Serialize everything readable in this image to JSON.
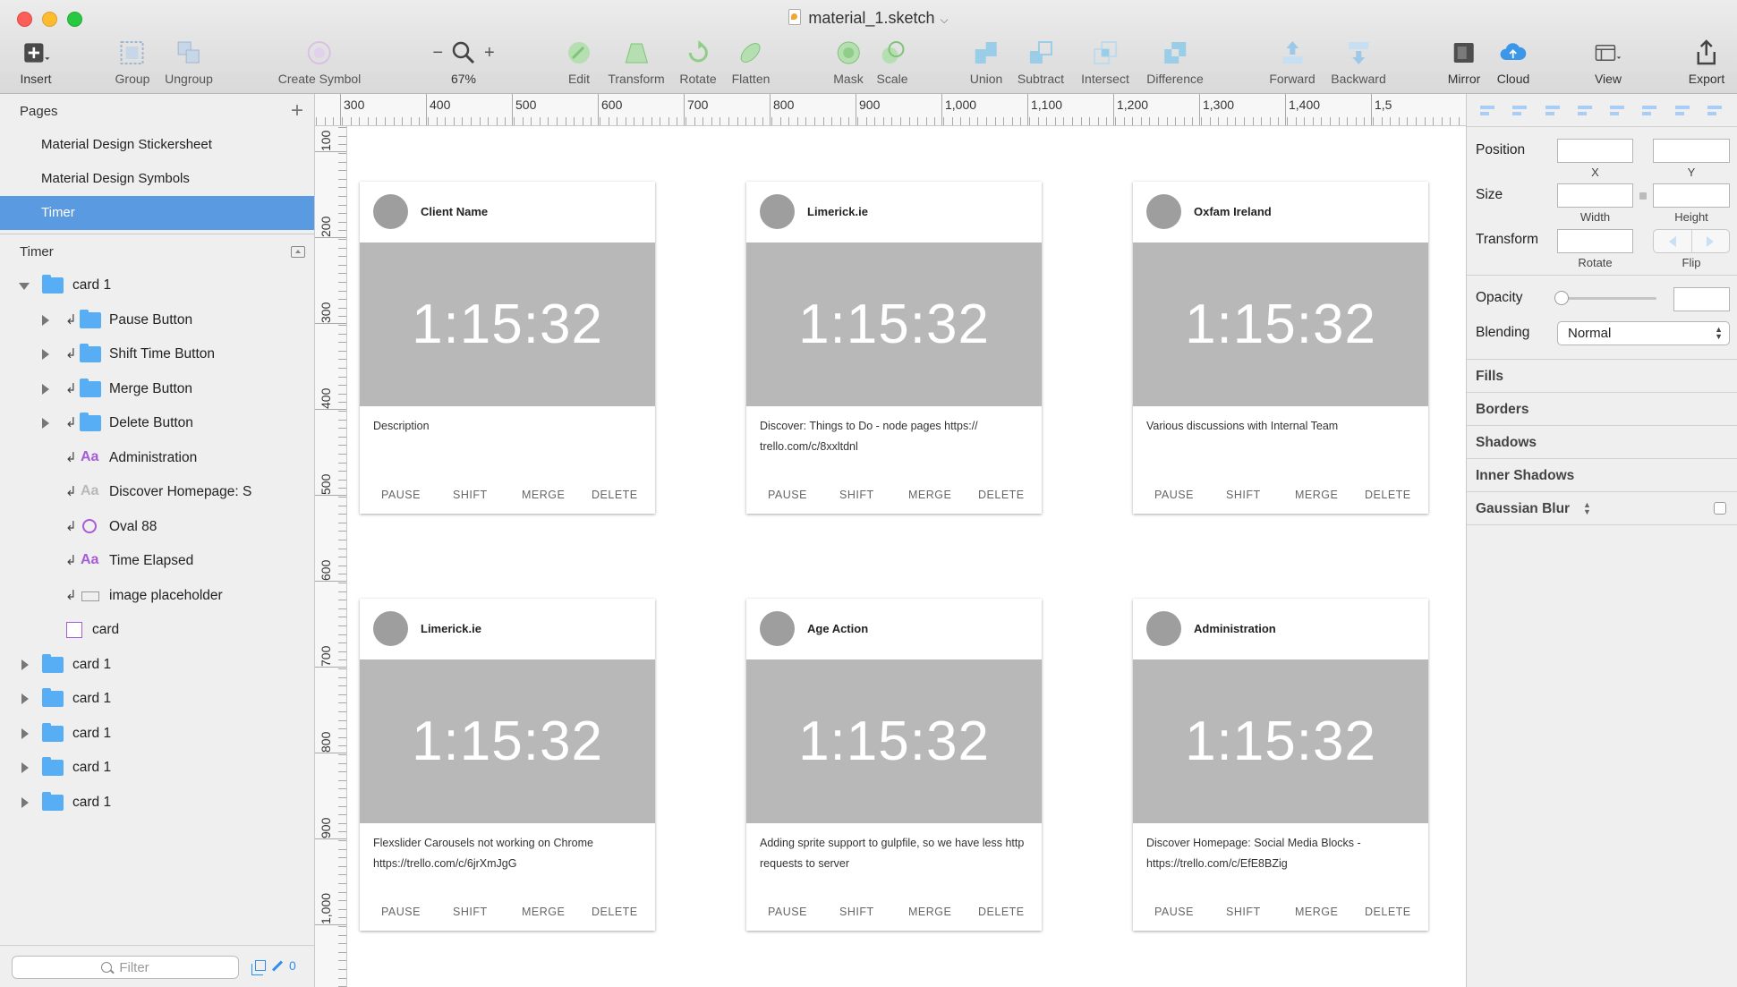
{
  "window": {
    "title": "material_1.sketch",
    "colors": {
      "accent": "#5a9ae0",
      "card_timer_bg": "#b8b8b8",
      "avatar": "#9e9e9e"
    }
  },
  "toolbar": {
    "insert": "Insert",
    "group": "Group",
    "ungroup": "Ungroup",
    "create_symbol": "Create Symbol",
    "zoom_minus": "−",
    "zoom_plus": "+",
    "zoom_level": "67%",
    "edit": "Edit",
    "transform": "Transform",
    "rotate": "Rotate",
    "flatten": "Flatten",
    "mask": "Mask",
    "scale": "Scale",
    "union": "Union",
    "subtract": "Subtract",
    "intersect": "Intersect",
    "difference": "Difference",
    "forward": "Forward",
    "backward": "Backward",
    "mirror": "Mirror",
    "cloud": "Cloud",
    "view": "View",
    "export": "Export"
  },
  "sidebar": {
    "pages_title": "Pages",
    "pages": [
      {
        "label": "Material Design Stickersheet"
      },
      {
        "label": "Material Design Symbols"
      },
      {
        "label": "Timer",
        "selected": true
      }
    ],
    "layers_title": "Timer",
    "layers": [
      {
        "label": "card 1",
        "type": "folder",
        "expanded": true
      },
      {
        "label": "Pause Button",
        "type": "folder"
      },
      {
        "label": "Shift Time Button",
        "type": "folder"
      },
      {
        "label": "Merge Button",
        "type": "folder"
      },
      {
        "label": "Delete Button",
        "type": "folder"
      },
      {
        "label": "Administration",
        "type": "text"
      },
      {
        "label": "Discover Homepage: S",
        "type": "text"
      },
      {
        "label": "Oval 88",
        "type": "oval"
      },
      {
        "label": "Time Elapsed",
        "type": "text"
      },
      {
        "label": "image placeholder",
        "type": "rect"
      },
      {
        "label": "card",
        "type": "shape"
      },
      {
        "label": "card 1",
        "type": "folder"
      },
      {
        "label": "card 1",
        "type": "folder"
      },
      {
        "label": "card 1",
        "type": "folder"
      },
      {
        "label": "card 1",
        "type": "folder"
      },
      {
        "label": "card 1",
        "type": "folder"
      }
    ],
    "filter_placeholder": "Filter",
    "filter_count": "0"
  },
  "ruler": {
    "top_labels": [
      "300",
      "400",
      "500",
      "600",
      "700",
      "800",
      "900",
      "1,000",
      "1,100",
      "1,200",
      "1,300",
      "1,400",
      "1,5"
    ],
    "left_labels": [
      "100",
      "200",
      "300",
      "400",
      "500",
      "600",
      "700",
      "800",
      "900",
      "1,000"
    ]
  },
  "cards": [
    {
      "client": "Client Name",
      "time": "1:15:32",
      "description": "Description"
    },
    {
      "client": "Limerick.ie",
      "time": "1:15:32",
      "description": "Discover: Things to Do - node pages https:// trello.com/c/8xxltdnl"
    },
    {
      "client": "Oxfam Ireland",
      "time": "1:15:32",
      "description": "Various discussions with Internal Team"
    },
    {
      "client": "Limerick.ie",
      "time": "1:15:32",
      "description": "Flexslider Carousels not working on Chrome https://trello.com/c/6jrXmJgG"
    },
    {
      "client": "Age Action",
      "time": "1:15:32",
      "description": "Adding sprite support to gulpfile, so we have less http requests to server"
    },
    {
      "client": "Administration",
      "time": "1:15:32",
      "description": "Discover Homepage: Social Media Blocks - https://trello.com/c/EfE8BZig"
    }
  ],
  "card_actions": {
    "pause": "PAUSE",
    "shift": "SHIFT",
    "merge": "MERGE",
    "delete": "DELETE"
  },
  "inspector": {
    "position": "Position",
    "x": "X",
    "y": "Y",
    "size": "Size",
    "width": "Width",
    "height": "Height",
    "transform": "Transform",
    "rotate": "Rotate",
    "flip": "Flip",
    "opacity": "Opacity",
    "blending": "Blending",
    "blending_value": "Normal",
    "fills": "Fills",
    "borders": "Borders",
    "shadows": "Shadows",
    "inner_shadows": "Inner Shadows",
    "gaussian_blur": "Gaussian Blur"
  }
}
